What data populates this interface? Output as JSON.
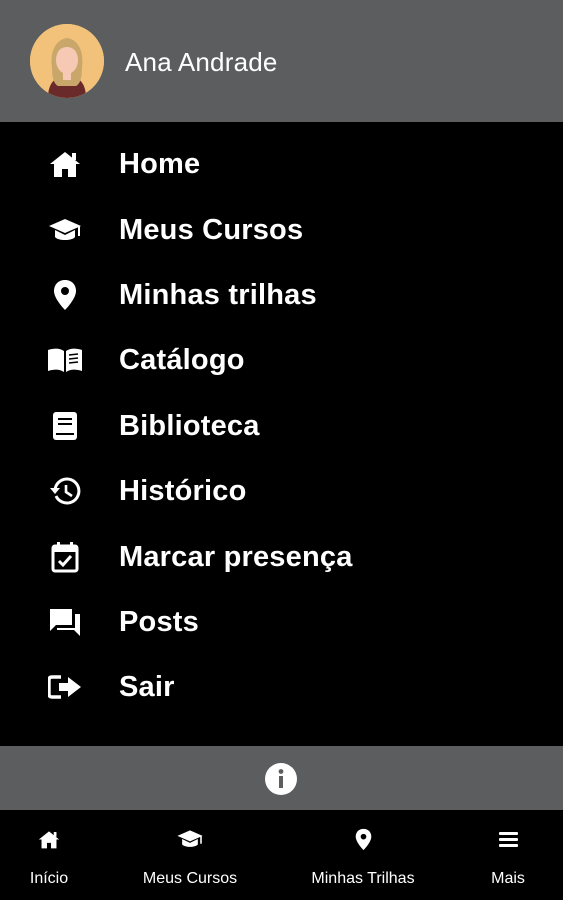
{
  "user": {
    "name": "Ana Andrade"
  },
  "menu": {
    "items": [
      {
        "label": "Home",
        "icon": "home-icon"
      },
      {
        "label": "Meus Cursos",
        "icon": "graduation-cap-icon"
      },
      {
        "label": "Minhas trilhas",
        "icon": "map-pin-icon"
      },
      {
        "label": "Catálogo",
        "icon": "open-book-icon"
      },
      {
        "label": "Biblioteca",
        "icon": "book-icon"
      },
      {
        "label": "Histórico",
        "icon": "history-icon"
      },
      {
        "label": "Marcar presença",
        "icon": "calendar-check-icon"
      },
      {
        "label": "Posts",
        "icon": "chat-bubbles-icon"
      },
      {
        "label": "Sair",
        "icon": "sign-out-icon"
      }
    ]
  },
  "info_bar": {
    "icon": "info-icon"
  },
  "bottom_nav": {
    "items": [
      {
        "label": "Início",
        "icon": "home-icon"
      },
      {
        "label": "Meus Cursos",
        "icon": "graduation-cap-icon"
      },
      {
        "label": "Minhas Trilhas",
        "icon": "map-pin-icon"
      },
      {
        "label": "Mais",
        "icon": "menu-icon"
      }
    ]
  },
  "colors": {
    "header_bg": "#5c5d5f",
    "menu_bg": "#000000",
    "text": "#ffffff",
    "avatar_bg": "#f2c27b"
  }
}
